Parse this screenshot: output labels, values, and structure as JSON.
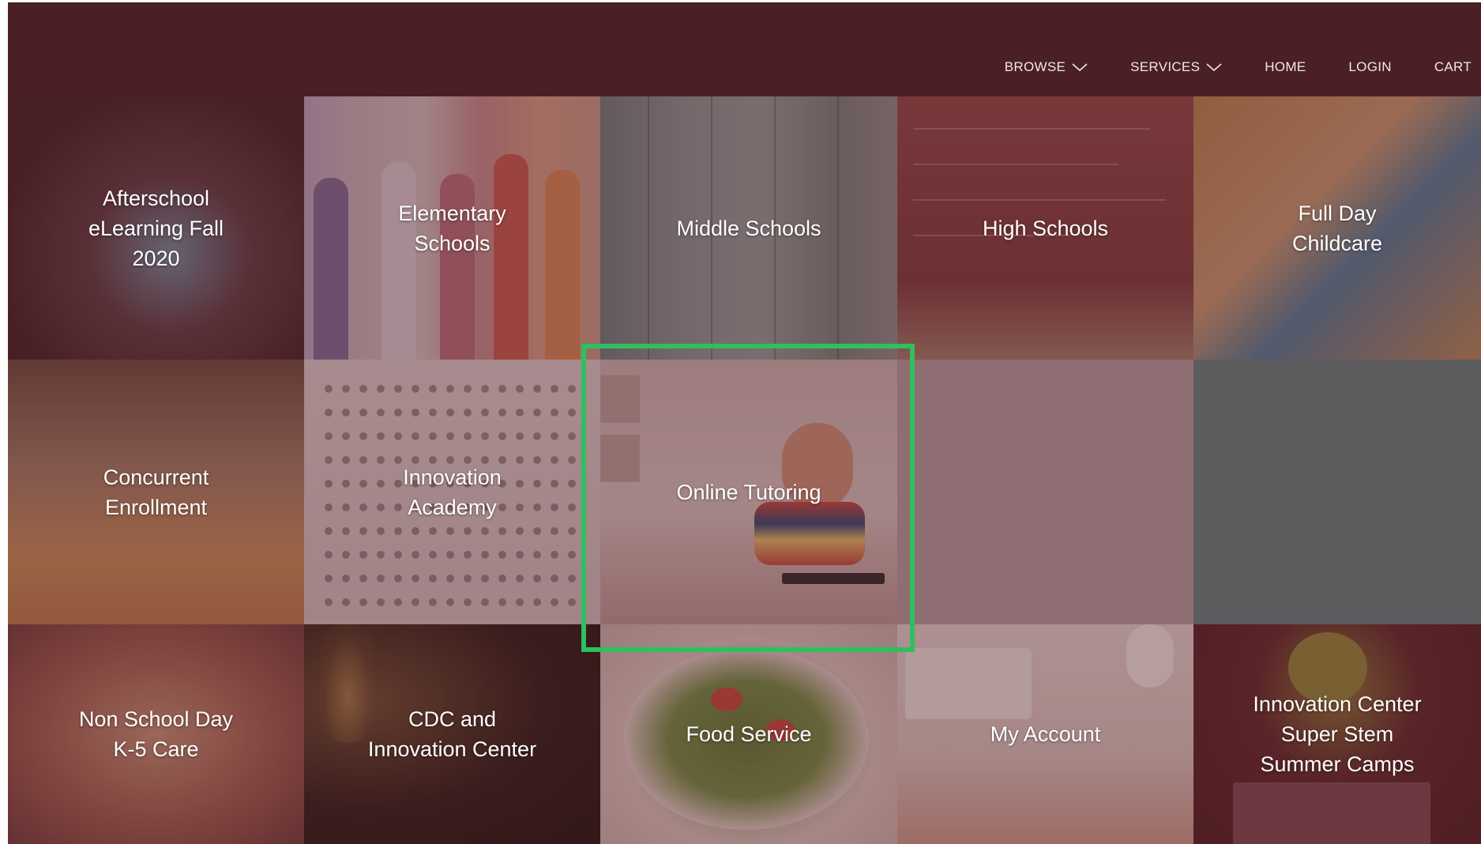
{
  "nav": {
    "items": [
      {
        "label": "BROWSE",
        "icon": "chevron-down-icon"
      },
      {
        "label": "SERVICES",
        "icon": "chevron-down-icon"
      },
      {
        "label": "HOME"
      },
      {
        "label": "LOGIN"
      },
      {
        "label": "CART"
      }
    ]
  },
  "colors": {
    "header_bg": "#4a2024",
    "nav_text": "#f1e7e7",
    "tile_overlay": "rgba(88, 28, 34, 0.38)",
    "highlight": "#2fbf5f"
  },
  "tiles": [
    {
      "label": "Afterschool\neLearning Fall\n2020"
    },
    {
      "label": "Elementary\nSchools"
    },
    {
      "label": "Middle Schools"
    },
    {
      "label": "High Schools"
    },
    {
      "label": "Full Day\nChildcare"
    },
    {
      "label": "Concurrent\nEnrollment"
    },
    {
      "label": "Innovation\nAcademy"
    },
    {
      "label": "Online Tutoring"
    },
    {
      "label": "Non School Day\nK-5 Care"
    },
    {
      "label": "CDC and\nInnovation Center"
    },
    {
      "label": "Food Service"
    },
    {
      "label": "My Account"
    },
    {
      "label": "Innovation Center\nSuper Stem\nSummer Camps"
    }
  ]
}
